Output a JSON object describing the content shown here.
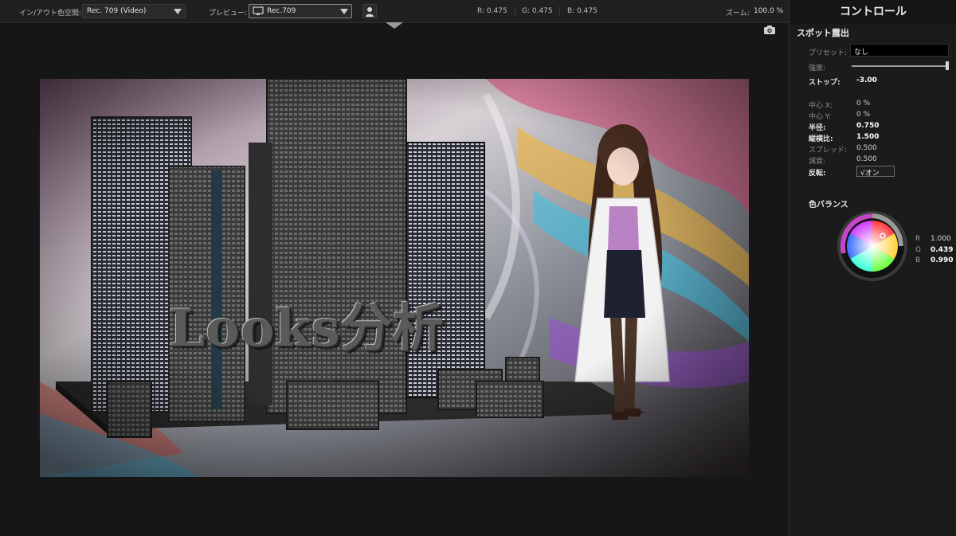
{
  "toolbar": {
    "colorspace_label": "イン/アウト色空間:",
    "colorspace_value": "Rec. 709 (Video)",
    "preview_label": "プレビュー:",
    "preview_value": "Rec.709",
    "readout_r": "R: 0.475",
    "readout_g": "G: 0.475",
    "readout_b": "B: 0.475",
    "zoom_label": "ズーム:",
    "zoom_value": "100.0 %"
  },
  "viewer": {
    "overlay_title": "Looks分析"
  },
  "panel": {
    "title": "コントロール",
    "section": "スポット露出",
    "preset_label": "プリセット:",
    "preset_value": "なし",
    "strength_label": "強度:",
    "strength_level": 1.0,
    "stop_label": "ストップ:",
    "stop_value": "-3.00",
    "center_x_label": "中心 X:",
    "center_x_value": "0 %",
    "center_y_label": "中心 Y:",
    "center_y_value": "0 %",
    "radius_label": "半径:",
    "radius_value": "0.750",
    "aspect_label": "縦横比:",
    "aspect_value": "1.500",
    "spread_label": "スプレッド:",
    "spread_value": "0.500",
    "falloff_label": "減衰:",
    "falloff_value": "0.500",
    "invert_label": "反転:",
    "invert_value": "√オン",
    "color_balance_title": "色バランス",
    "cb_r_label": "R",
    "cb_r_value": "1.000",
    "cb_g_label": "G",
    "cb_g_value": "0.439",
    "cb_b_label": "B",
    "cb_b_value": "0.990"
  },
  "icons": {
    "monitor": "monitor-icon",
    "person": "person-icon",
    "camera": "camera-icon",
    "panel_toggle": "triangle-down-icon"
  },
  "colors": {
    "toolbar_bg": "#202020",
    "panel_bg": "#1b1b1b",
    "viewer_bg": "#161616"
  }
}
